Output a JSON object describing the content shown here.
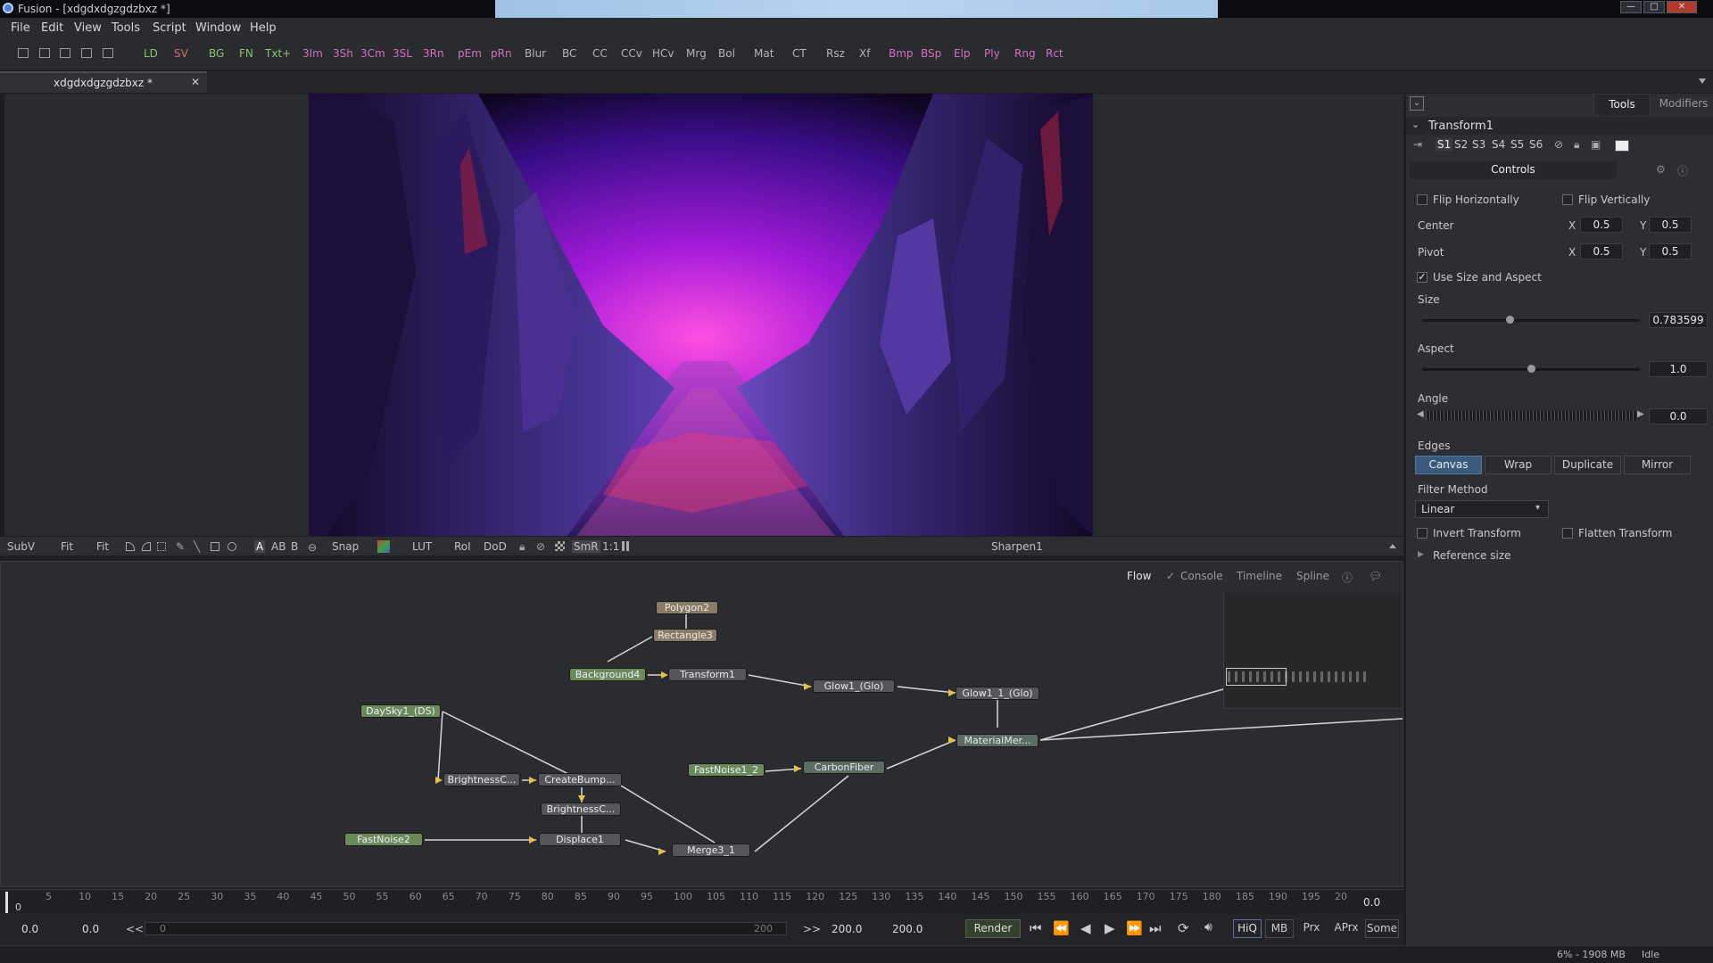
{
  "window": {
    "title": "Fusion - [xdgdxdgzgdzbxz *]"
  },
  "menu": [
    "File",
    "Edit",
    "View",
    "Tools",
    "Script",
    "Window",
    "Help"
  ],
  "toolbar": {
    "buttons": [
      {
        "label": "LD",
        "color": "green"
      },
      {
        "label": "SV",
        "color": "red"
      },
      {
        "label": "BG",
        "color": "green"
      },
      {
        "label": "FN",
        "color": "green"
      },
      {
        "label": "Txt+",
        "color": "green"
      },
      {
        "label": "3Im",
        "color": "pink"
      },
      {
        "label": "3Sh",
        "color": "pink"
      },
      {
        "label": "3Cm",
        "color": "pink"
      },
      {
        "label": "3SL",
        "color": "pink"
      },
      {
        "label": "3Rn",
        "color": "pink"
      },
      {
        "label": "pEm",
        "color": "pink"
      },
      {
        "label": "pRn",
        "color": "pink"
      },
      {
        "label": "Blur",
        "color": "plain"
      },
      {
        "label": "BC",
        "color": "plain"
      },
      {
        "label": "CC",
        "color": "plain"
      },
      {
        "label": "CCv",
        "color": "plain"
      },
      {
        "label": "HCv",
        "color": "plain"
      },
      {
        "label": "Mrg",
        "color": "plain"
      },
      {
        "label": "Bol",
        "color": "plain"
      },
      {
        "label": "Mat",
        "color": "plain"
      },
      {
        "label": "CT",
        "color": "plain"
      },
      {
        "label": "Rsz",
        "color": "plain"
      },
      {
        "label": "Xf",
        "color": "plain"
      },
      {
        "label": "Bmp",
        "color": "pink"
      },
      {
        "label": "BSp",
        "color": "pink"
      },
      {
        "label": "Elp",
        "color": "pink"
      },
      {
        "label": "Ply",
        "color": "pink"
      },
      {
        "label": "Rng",
        "color": "pink"
      },
      {
        "label": "Rct",
        "color": "pink"
      }
    ]
  },
  "document_tab": {
    "label": "xdgdxdgzgdzbxz *"
  },
  "viewer_toolbar": {
    "subv": "SubV",
    "fit1": "Fit",
    "fit2": "Fit",
    "a": "A",
    "ab": "AB",
    "b": "B",
    "snap": "Snap",
    "lut": "LUT",
    "roi": "RoI",
    "dod": "DoD",
    "smr": "SmR",
    "ratio": "1:1",
    "viewer_name": "Sharpen1"
  },
  "flow_tabs": [
    "Flow",
    "Console",
    "Timeline",
    "Spline"
  ],
  "nodes": [
    {
      "label": "Polygon2",
      "style": "brown"
    },
    {
      "label": "Rectangle3",
      "style": "brown"
    },
    {
      "label": "Background4",
      "style": "green"
    },
    {
      "label": "Transform1",
      "style": "grey"
    },
    {
      "label": "Glow1_(Glo)",
      "style": "grey"
    },
    {
      "label": "Glow1_1_(Glo)",
      "style": "grey"
    },
    {
      "label": "DaySky1_(DS)",
      "style": "green"
    },
    {
      "label": "MaterialMer...",
      "style": "teal"
    },
    {
      "label": "FastNoise1_2",
      "style": "green"
    },
    {
      "label": "CarbonFiber",
      "style": "teal"
    },
    {
      "label": "BrightnessC...",
      "style": "grey"
    },
    {
      "label": "CreateBump...",
      "style": "grey"
    },
    {
      "label": "BrightnessC...",
      "style": "grey"
    },
    {
      "label": "FastNoise2",
      "style": "green"
    },
    {
      "label": "Displace1",
      "style": "grey"
    },
    {
      "label": "Merge3_1",
      "style": "grey"
    }
  ],
  "ruler": {
    "ticks": [
      "0",
      "5",
      "10",
      "15",
      "20",
      "25",
      "30",
      "35",
      "40",
      "45",
      "50",
      "55",
      "60",
      "65",
      "70",
      "75",
      "80",
      "85",
      "90",
      "95",
      "100",
      "105",
      "110",
      "115",
      "120",
      "125",
      "130",
      "135",
      "140",
      "145",
      "150",
      "155",
      "160",
      "165",
      "170",
      "175",
      "180",
      "185",
      "190",
      "195",
      "20"
    ],
    "current": "0.0"
  },
  "transport": {
    "global_start": "0.0",
    "render_start": "0.0",
    "prev": "<<",
    "range_start": "0",
    "range_end": "200",
    "next": ">>",
    "render_end": "200.0",
    "global_end": "200.0",
    "render": "Render",
    "hiq": "HiQ",
    "mb": "MB",
    "prx": "Prx",
    "aprx": "APrx",
    "some": "Some"
  },
  "status": {
    "memory": "6% - 1908 MB",
    "state": "Idle"
  },
  "panel": {
    "tabs": [
      "Tools",
      "Modifiers"
    ],
    "tool_name": "Transform1",
    "slots": [
      "S1",
      "S2",
      "S3",
      "S4",
      "S5",
      "S6"
    ],
    "controls_tab": "Controls",
    "flip_h": "Flip Horizontally",
    "flip_v": "Flip Vertically",
    "center": {
      "label": "Center",
      "x_label": "X",
      "x": "0.5",
      "y_label": "Y",
      "y": "0.5"
    },
    "pivot": {
      "label": "Pivot",
      "x_label": "X",
      "x": "0.5",
      "y_label": "Y",
      "y": "0.5"
    },
    "use_size": "Use Size and Aspect",
    "size": {
      "label": "Size",
      "value": "0.783599",
      "level": 0.3
    },
    "aspect": {
      "label": "Aspect",
      "value": "1.0",
      "level": 0.5
    },
    "angle": {
      "label": "Angle",
      "value": "0.0"
    },
    "edges": {
      "label": "Edges",
      "options": [
        "Canvas",
        "Wrap",
        "Duplicate",
        "Mirror"
      ],
      "selected": "Canvas"
    },
    "filter": {
      "label": "Filter Method",
      "value": "Linear"
    },
    "invert": "Invert Transform",
    "flatten": "Flatten Transform",
    "reference": "Reference size"
  }
}
